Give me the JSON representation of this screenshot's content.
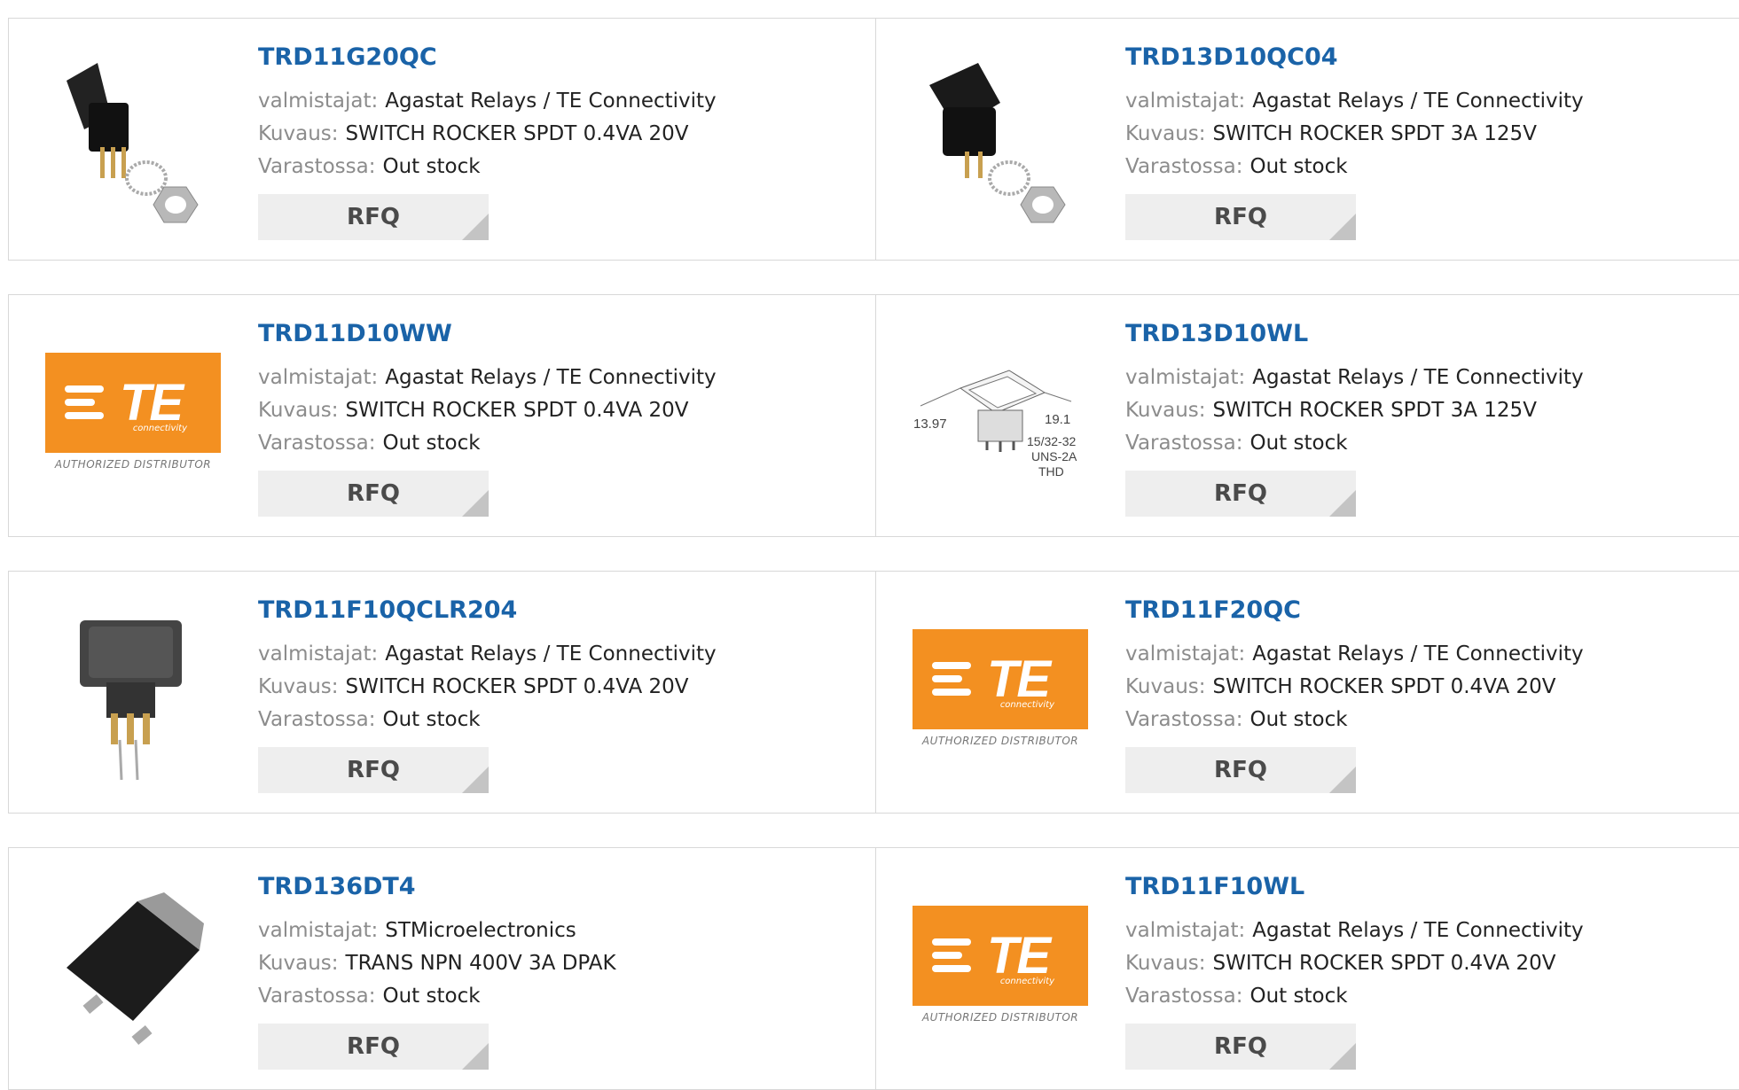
{
  "labels": {
    "manufacturer": "valmistajat:",
    "description": "Kuvaus:",
    "stock": "Varastossa:",
    "rfq": "RFQ"
  },
  "te_logo": {
    "word": "TE",
    "sub": "connectivity",
    "authorized": "AUTHORIZED DISTRIBUTOR"
  },
  "drawing": {
    "w": "13.97",
    "h": "19.1",
    "thread1": "15/32-32",
    "thread2": "UNS-2A",
    "thread3": "THD"
  },
  "products": [
    {
      "pn": "TRD11G20QC",
      "manufacturer": "Agastat Relays / TE Connectivity",
      "description": "SWITCH ROCKER SPDT 0.4VA 20V",
      "stock": "Out stock",
      "image": "toggle-switch-icon"
    },
    {
      "pn": "TRD13D10QC04",
      "manufacturer": "Agastat Relays / TE Connectivity",
      "description": "SWITCH ROCKER SPDT 3A 125V",
      "stock": "Out stock",
      "image": "rocker-switch-icon"
    },
    {
      "pn": "TRD11D10WW",
      "manufacturer": "Agastat Relays / TE Connectivity",
      "description": "SWITCH ROCKER SPDT 0.4VA 20V",
      "stock": "Out stock",
      "image": "te-logo"
    },
    {
      "pn": "TRD13D10WL",
      "manufacturer": "Agastat Relays / TE Connectivity",
      "description": "SWITCH ROCKER SPDT 3A 125V",
      "stock": "Out stock",
      "image": "switch-drawing"
    },
    {
      "pn": "TRD11F10QCLR204",
      "manufacturer": "Agastat Relays / TE Connectivity",
      "description": "SWITCH ROCKER SPDT 0.4VA 20V",
      "stock": "Out stock",
      "image": "square-switch-icon"
    },
    {
      "pn": "TRD11F20QC",
      "manufacturer": "Agastat Relays / TE Connectivity",
      "description": "SWITCH ROCKER SPDT 0.4VA 20V",
      "stock": "Out stock",
      "image": "te-logo"
    },
    {
      "pn": "TRD136DT4",
      "manufacturer": "STMicroelectronics",
      "description": "TRANS NPN 400V 3A DPAK",
      "stock": "Out stock",
      "image": "dpak-transistor-icon"
    },
    {
      "pn": "TRD11F10WL",
      "manufacturer": "Agastat Relays / TE Connectivity",
      "description": "SWITCH ROCKER SPDT 0.4VA 20V",
      "stock": "Out stock",
      "image": "te-logo"
    }
  ]
}
